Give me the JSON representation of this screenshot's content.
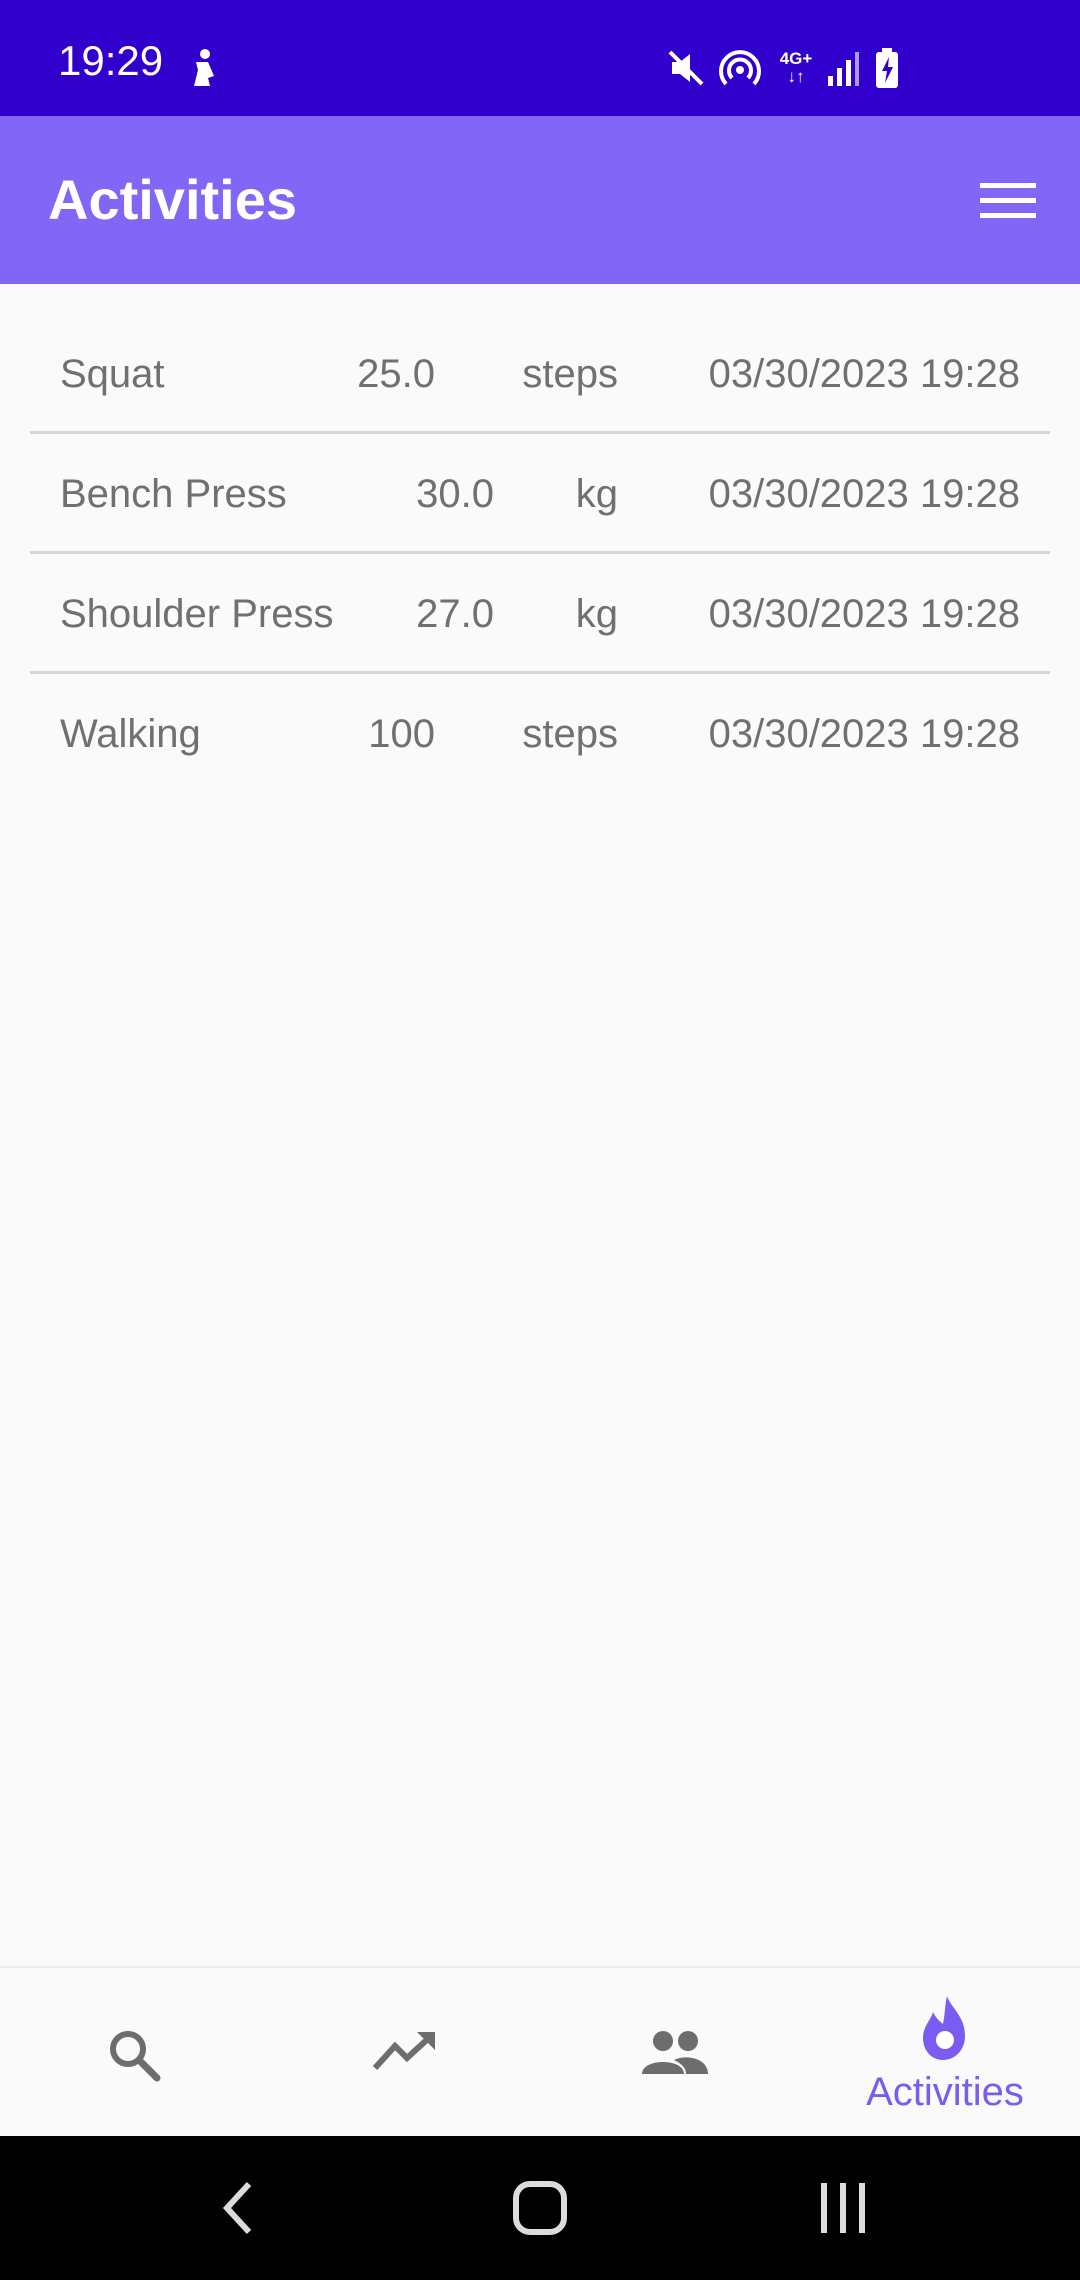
{
  "status_bar": {
    "time": "19:29",
    "icons": [
      "person-icon",
      "mute-icon",
      "hotspot-icon",
      "4g-icon",
      "signal-icon",
      "battery-charging-icon"
    ],
    "network_label": "4G+"
  },
  "app_bar": {
    "title": "Activities",
    "menu_icon": "hamburger-menu-icon"
  },
  "activities": [
    {
      "name": "Squat",
      "value": "25.0",
      "unit": "steps",
      "date": "03/30/2023 19:28"
    },
    {
      "name": "Bench Press",
      "value": "30.0",
      "unit": "kg",
      "date": "03/30/2023 19:28"
    },
    {
      "name": "Shoulder Press",
      "value": "27.0",
      "unit": "kg",
      "date": "03/30/2023 19:28"
    },
    {
      "name": "Walking",
      "value": "100",
      "unit": "steps",
      "date": "03/30/2023 19:28"
    }
  ],
  "bottom_nav": {
    "items": [
      {
        "icon": "search-icon",
        "label": ""
      },
      {
        "icon": "trending-up-icon",
        "label": ""
      },
      {
        "icon": "people-icon",
        "label": ""
      },
      {
        "icon": "flame-icon",
        "label": "Activities"
      }
    ],
    "active_index": 3
  },
  "colors": {
    "status_bar": "#3200cc",
    "app_bar": "#8266f5",
    "accent": "#7a5df0",
    "text": "#707070"
  }
}
